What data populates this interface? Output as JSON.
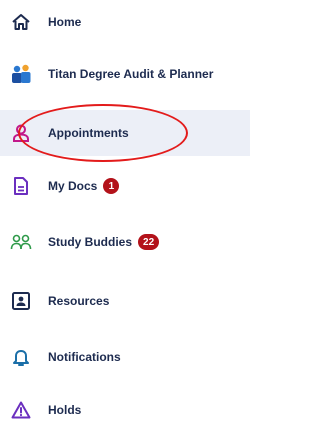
{
  "nav": {
    "items": [
      {
        "label": "Home",
        "icon": "home-icon"
      },
      {
        "label": "Titan Degree Audit & Planner",
        "icon": "people-icon"
      },
      {
        "label": "Appointments",
        "icon": "person-icon",
        "active": true
      },
      {
        "label": "My Docs",
        "icon": "document-icon",
        "badge": "1"
      },
      {
        "label": "Study Buddies",
        "icon": "study-buddies-icon",
        "badge": "22"
      },
      {
        "label": "Resources",
        "icon": "resources-icon"
      },
      {
        "label": "Notifications",
        "icon": "bell-icon"
      },
      {
        "label": "Holds",
        "icon": "warning-icon"
      }
    ]
  },
  "colors": {
    "text": "#1d2b4f",
    "icon_blue": "#1c4fa1",
    "icon_green": "#2f9a4a",
    "icon_magenta": "#c2188a",
    "icon_purple": "#6b2fbf",
    "badge_bg": "#b3121a",
    "highlight_ring": "#e31b1b",
    "active_bg": "#eceff7"
  }
}
